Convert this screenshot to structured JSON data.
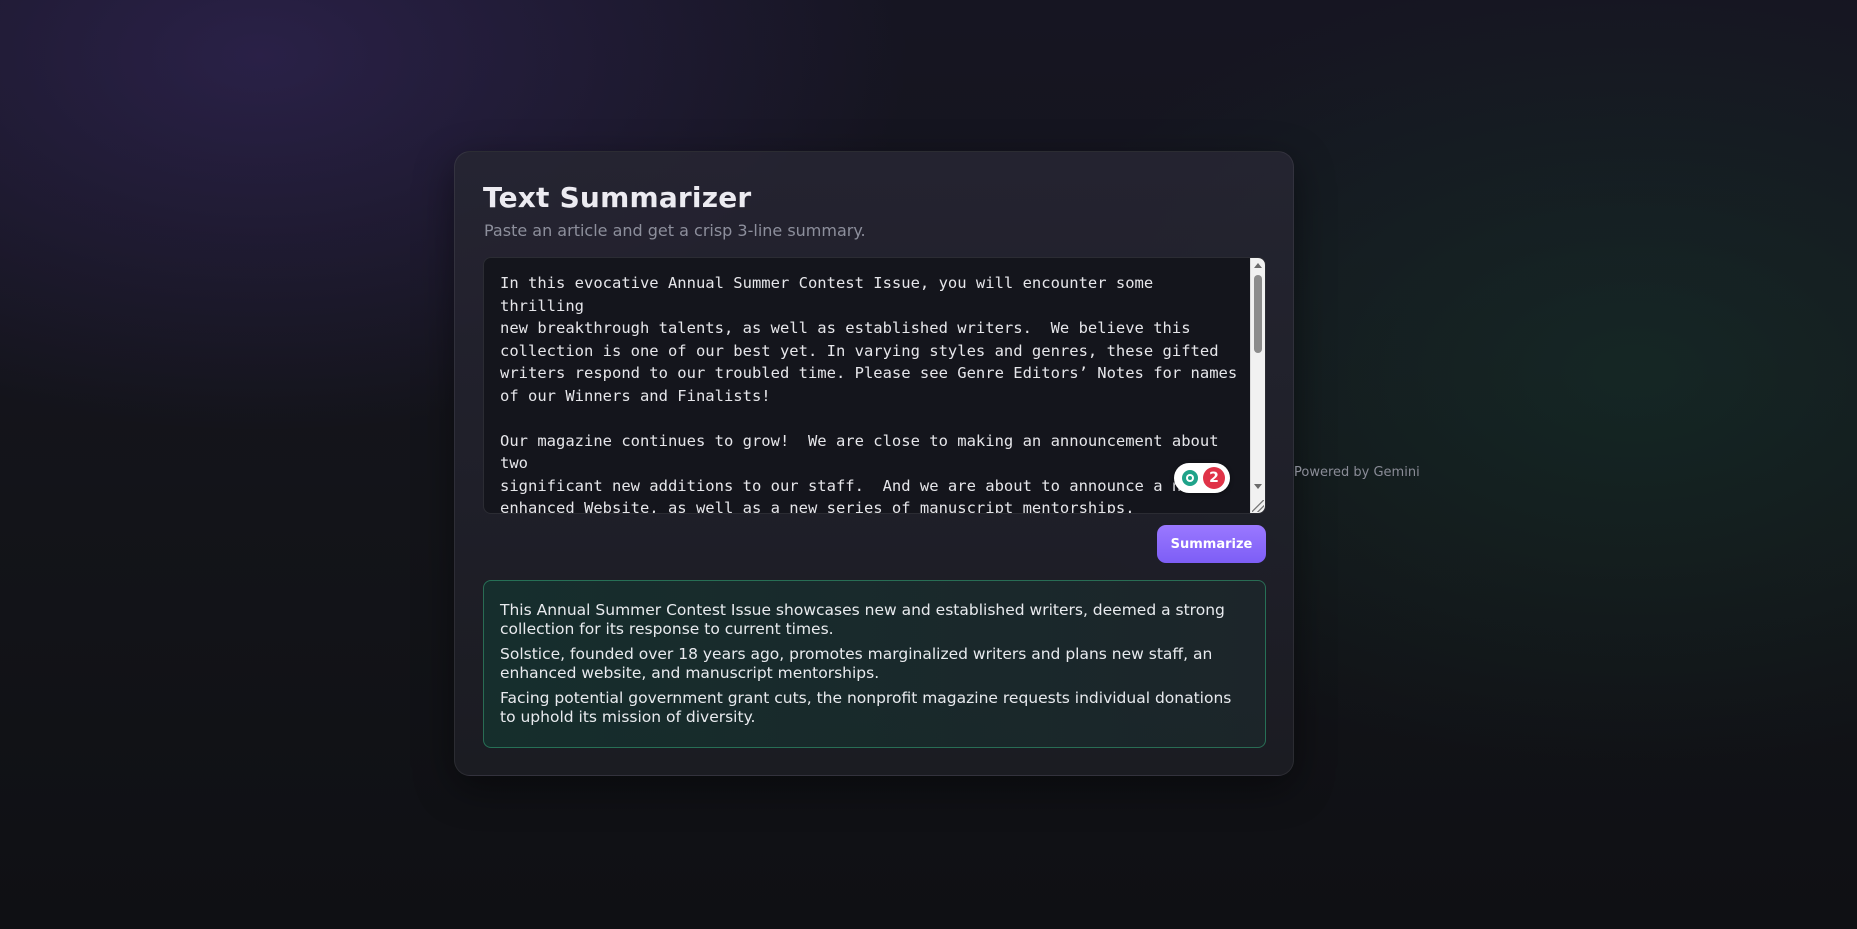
{
  "app": {
    "title": "Text Summarizer",
    "subtitle": "Paste an article and get a crisp 3-line summary."
  },
  "input": {
    "text": "In this evocative Annual Summer Contest Issue, you will encounter some thrilling\nnew breakthrough talents, as well as established writers.  We believe this\ncollection is one of our best yet. In varying styles and genres, these gifted\nwriters respond to our troubled time. Please see Genre Editors’ Notes for names\nof our Winners and Finalists!\n\nOur magazine continues to grow!  We are close to making an announcement about two\nsignificant new additions to our staff.  And we are about to announce a new\nenhanced Website, as well as a new series of manuscript mentorships.\n\nFounded over eighteen years ago, Solstice: A Magazine of Diverse Voices is one of"
  },
  "extension_badge": {
    "icon": "grammar-extension-icon",
    "count": "2",
    "colors": {
      "icon": "#1fa38a",
      "count_bg": "#e03348"
    }
  },
  "powered_by": "Powered by Gemini",
  "actions": {
    "summarize_label": "Summarize"
  },
  "summary": {
    "lines": [
      "This Annual Summer Contest Issue showcases new and established writers, deemed a strong collection for its response to current times.",
      "Solstice, founded over 18 years ago, promotes marginalized writers and plans new staff, an enhanced website, and manuscript mentorships.",
      "Facing potential government grant cuts, the nonprofit magazine requests individual donations to uphold its mission of diversity."
    ]
  },
  "colors": {
    "accent": "#8b6cfa",
    "summary_border": "#34a878",
    "background": "#131419"
  }
}
